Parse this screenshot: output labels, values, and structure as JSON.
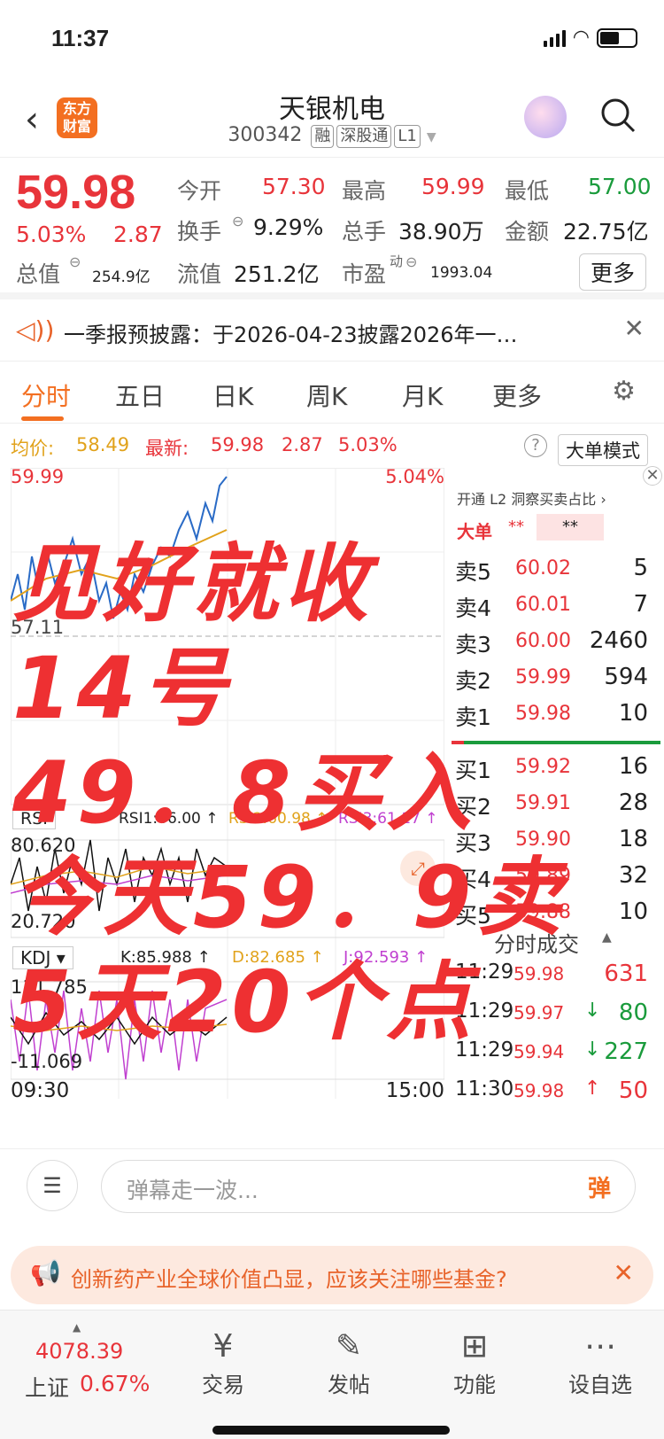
{
  "status": {
    "time": "11:37"
  },
  "header": {
    "logo": "东方\n财富",
    "title": "天银机电",
    "code": "300342",
    "tags": [
      "融",
      "深股通",
      "L1"
    ]
  },
  "quote": {
    "price": "59.98",
    "change_pct": "5.03%",
    "change": "2.87",
    "open_label": "今开",
    "open": "57.30",
    "high_label": "最高",
    "high": "59.99",
    "low_label": "最低",
    "low": "57.00",
    "turnover_label": "换手",
    "turnover": "9.29%",
    "volume_label": "总手",
    "volume": "38.90万",
    "amount_label": "金额",
    "amount": "22.75亿",
    "mktcap_label": "总值",
    "mktcap": "254.9亿",
    "float_label": "流值",
    "float": "251.2亿",
    "pe_label": "市盈",
    "pe_sup": "动",
    "pe": "1993.04",
    "more": "更多"
  },
  "notice": {
    "text": "一季报预披露：于2026-04-23披露2026年一…"
  },
  "tabs": [
    "分时",
    "五日",
    "日K",
    "周K",
    "月K",
    "更多"
  ],
  "info": {
    "avg_label": "均价:",
    "avg": "58.49",
    "latest_label": "最新:",
    "latest": "59.98",
    "latest_change": "2.87",
    "latest_pct": "5.03%",
    "big_mode": "大单模式"
  },
  "chart": {
    "y_top": "59.99",
    "y_mid": "57.11",
    "pct_top": "5.04%",
    "rsi_label": "RSI",
    "rsi1": "RSI1:66.00 ↑",
    "rsi2": "RSI2:60.98 ↑",
    "rsi3": "RSI3:61.17 ↑",
    "rsi_top": "80.620",
    "rsi_bottom": "20.720",
    "kdj_label": "KDJ",
    "kdj_k": "K:85.988 ↑",
    "kdj_d": "D:82.685 ↑",
    "kdj_j": "J:92.593 ↑",
    "kdj_top": "111.785",
    "kdj_bottom": "-11.069",
    "time_start": "09:30",
    "time_end": "15:00"
  },
  "orderbook": {
    "promo": "开通 L2 洞察买卖占比 ›",
    "big_label": "大单",
    "asks": [
      {
        "label": "卖5",
        "price": "60.02",
        "vol": "5"
      },
      {
        "label": "卖4",
        "price": "60.01",
        "vol": "7"
      },
      {
        "label": "卖3",
        "price": "60.00",
        "vol": "2460"
      },
      {
        "label": "卖2",
        "price": "59.99",
        "vol": "594"
      },
      {
        "label": "卖1",
        "price": "59.98",
        "vol": "10"
      }
    ],
    "bids": [
      {
        "label": "买1",
        "price": "59.92",
        "vol": "16"
      },
      {
        "label": "买2",
        "price": "59.91",
        "vol": "28"
      },
      {
        "label": "买3",
        "price": "59.90",
        "vol": "18"
      },
      {
        "label": "买4",
        "price": "59.89",
        "vol": "32"
      },
      {
        "label": "买5",
        "price": "59.88",
        "vol": "10"
      }
    ],
    "ticks_title": "分时成交",
    "ticks": [
      {
        "time": "11:29",
        "price": "59.98",
        "vol": "631",
        "dir": ""
      },
      {
        "time": "11:29",
        "price": "59.97",
        "vol": "80",
        "dir": "↓"
      },
      {
        "time": "11:29",
        "price": "59.94",
        "vol": "227",
        "dir": "↓"
      },
      {
        "time": "11:30",
        "price": "59.98",
        "vol": "50",
        "dir": "↑"
      }
    ]
  },
  "overlay": [
    "见好就收",
    "14号",
    "49．8买入",
    "今天59．9卖",
    "5天20个点"
  ],
  "comment": {
    "placeholder": "弹幕走一波...",
    "danmu": "弹"
  },
  "ad": {
    "text": "创新药产业全球价值凸显，应该关注哪些基金?"
  },
  "bottom": {
    "index_value": "4078.39",
    "index_name": "上证",
    "index_pct": "0.67%",
    "items": [
      "交易",
      "发帖",
      "功能",
      "设自选"
    ]
  },
  "colors": {
    "up": "#e8343a",
    "down": "#1a9b3c",
    "accent": "#f36f21"
  }
}
